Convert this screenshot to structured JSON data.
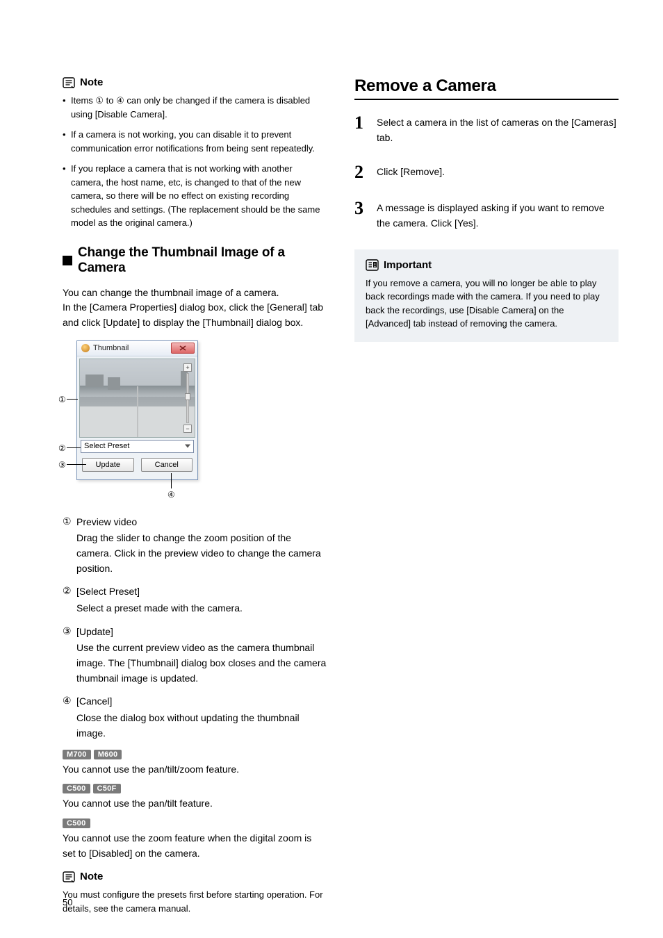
{
  "left": {
    "note_label": "Note",
    "note_bullets": [
      "Items ① to ④ can only be changed if the camera is disabled using [Disable Camera].",
      "If a camera is not working, you can disable it to prevent communication error notifications from being sent repeatedly.",
      "If you replace a camera that is not working with another camera, the host name, etc, is changed to that of the new camera, so there will be no effect on existing recording schedules and settings. (The replacement should be the same model as the original camera.)"
    ],
    "sub_heading": "Change the Thumbnail Image of a Camera",
    "intro": "You can change the thumbnail image of a camera.\nIn the [Camera Properties] dialog box, click the [General] tab and click [Update] to display the [Thumbnail] dialog box.",
    "dialog": {
      "title": "Thumbnail",
      "select_placeholder": "Select Preset",
      "btn_update": "Update",
      "btn_cancel": "Cancel"
    },
    "callouts": {
      "c1": "①",
      "c2": "②",
      "c3": "③",
      "c4": "④"
    },
    "items": [
      {
        "num": "①",
        "title": "Preview video",
        "desc": "Drag the slider to change the zoom position of the camera. Click in the preview video to change the camera position."
      },
      {
        "num": "②",
        "title": "[Select Preset]",
        "desc": "Select a preset made with the camera."
      },
      {
        "num": "③",
        "title": "[Update]",
        "desc": "Use the current preview video as the camera thumbnail image. The [Thumbnail] dialog box closes and the camera thumbnail image is updated."
      },
      {
        "num": "④",
        "title": "[Cancel]",
        "desc": "Close the dialog box without updating the thumbnail image."
      }
    ],
    "restrict": [
      {
        "badges": [
          "M700",
          "M600"
        ],
        "text": "You cannot use the pan/tilt/zoom feature."
      },
      {
        "badges": [
          "C500",
          "C50F"
        ],
        "text": "You cannot use the pan/tilt feature."
      },
      {
        "badges": [
          "C500"
        ],
        "text": "You cannot use the zoom feature when the digital zoom is set to [Disabled] on the camera."
      }
    ],
    "note2_label": "Note",
    "note2_text": "You must configure the presets first before starting operation. For details, see the camera manual."
  },
  "right": {
    "title": "Remove a Camera",
    "steps": [
      {
        "n": "1",
        "t": "Select a camera in the list of cameras on the [Cameras] tab."
      },
      {
        "n": "2",
        "t": "Click [Remove]."
      },
      {
        "n": "3",
        "t": "A message is displayed asking if you want to remove the camera. Click [Yes]."
      }
    ],
    "important_label": "Important",
    "important_text": "If you remove a camera, you will no longer be able to play back recordings made with the camera. If you need to play back the recordings, use [Disable Camera] on the [Advanced] tab instead of removing the camera."
  },
  "page_number": "50"
}
